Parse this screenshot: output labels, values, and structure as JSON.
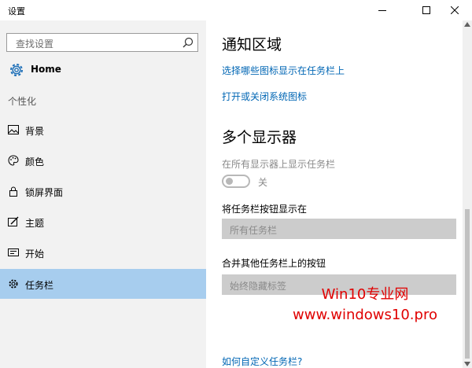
{
  "window": {
    "title": "设置"
  },
  "sidebar": {
    "search_placeholder": "查找设置",
    "home_label": "Home",
    "section_label": "个性化",
    "items": [
      {
        "label": "背景",
        "icon": "picture-icon"
      },
      {
        "label": "颜色",
        "icon": "palette-icon"
      },
      {
        "label": "锁屏界面",
        "icon": "lock-screen-icon"
      },
      {
        "label": "主题",
        "icon": "theme-icon"
      },
      {
        "label": "开始",
        "icon": "start-icon"
      },
      {
        "label": "任务栏",
        "icon": "taskbar-icon",
        "selected": true
      }
    ]
  },
  "main": {
    "notification_heading": "通知区域",
    "link_taskbar_icons": "选择哪些图标显示在任务栏上",
    "link_system_icons": "打开或关闭系统图标",
    "multi_display_heading": "多个显示器",
    "show_all_label": "在所有显示器上显示任务栏",
    "toggle_state": "关",
    "show_buttons_label": "将任务栏按钮显示在",
    "show_buttons_value": "所有任务栏",
    "combine_label": "合并其他任务栏上的按钮",
    "combine_value": "始终隐藏标签",
    "customize_link": "如何自定义任务栏?"
  },
  "watermark": {
    "line1": "Win10专业网",
    "line2": "www.windows10.pro"
  },
  "colors": {
    "accent_link": "#0066b4",
    "selected_nav": "#a7cdee",
    "sidebar_bg": "#f2f2f2",
    "watermark": "#e00000"
  }
}
